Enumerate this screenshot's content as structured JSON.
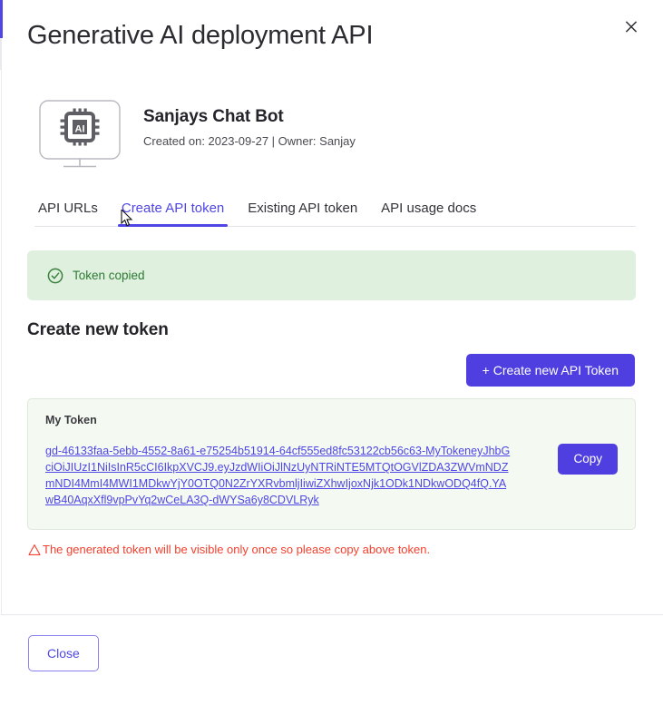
{
  "dialog": {
    "title": "Generative AI deployment API",
    "close_icon": "close-x-icon"
  },
  "app": {
    "icon": "ai-chip-monitor-icon",
    "name": "Sanjays Chat Bot",
    "meta": "Created on: 2023-09-27 | Owner: Sanjay"
  },
  "tabs": [
    {
      "label": "API URLs",
      "active": false
    },
    {
      "label": "Create API token",
      "active": true
    },
    {
      "label": "Existing API token",
      "active": false
    },
    {
      "label": "API usage docs",
      "active": false
    }
  ],
  "alert": {
    "icon": "check-circle-icon",
    "text": "Token copied",
    "bg_color": "#dff0df",
    "text_color": "#2c7a33"
  },
  "section": {
    "title": "Create new token",
    "create_button_label": "+ Create new API Token"
  },
  "token_panel": {
    "label": "My Token",
    "value": "gd-46133faa-5ebb-4552-8a61-e75254b51914-64cf555ed8fc53122cb56c63-MyTokeneyJhbGciOiJIUzI1NiIsInR5cCI6IkpXVCJ9.eyJzdWIiOiJlNzUyNTRiNTE5MTQtOGVlZDA3ZWVmNDZmNDI4MmI4MWI1MDkwYjY0OTQ0N2ZrYXRvbmljIiwiZXhwIjoxNjk1ODk1NDkwODQ4fQ.YAwB40AqxXfl9vpPvYq2wCeLA3Q-dWYSa6y8CDVLRyk",
    "copy_button_label": "Copy",
    "bg_color": "#f4faf2"
  },
  "warning": {
    "icon": "warning-triangle-icon",
    "text": "The generated token will be visible only once so please copy above token.",
    "color": "#f4402e"
  },
  "footer": {
    "close_button_label": "Close"
  },
  "theme": {
    "accent": "#4f46e5",
    "primary_button": "#4f3fe0"
  }
}
